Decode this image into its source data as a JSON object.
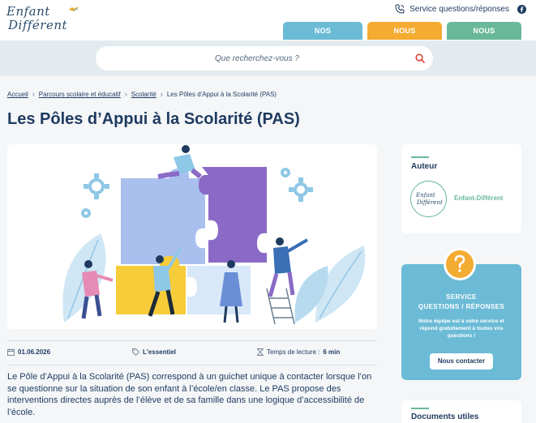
{
  "header": {
    "logo_line1": "Enfant",
    "logo_line2": "Différent",
    "service_link": "Service questions/réponses",
    "nav": [
      "NOS THÉMATIQUES",
      "NOUS CONNAÎTRE",
      "NOUS CONTACTER"
    ],
    "colors": {
      "blue": "#6bbbd6",
      "orange": "#f3ab32",
      "green": "#6ab89b"
    }
  },
  "search": {
    "placeholder": "Que recherchez-vous ?"
  },
  "breadcrumb": [
    "Accueil",
    "Parcours scolaire et éducatif",
    "Scolarité",
    "Les Pôles d'Appui à la Scolarité (PAS)"
  ],
  "page": {
    "title": "Les Pôles d’Appui à la Scolarité (PAS)",
    "date": "01.06.2026",
    "tag": "L'essentiel",
    "reading_label": "Temps de lecture :",
    "reading_time": "6 min",
    "intro": "Le Pôle d’Appui à la Scolarité (PAS) correspond à un guichet unique à contacter lorsque l’on se questionne sur la situation de son enfant à l’école/en classe. Le PAS propose des interventions directes auprès de l’élève et de sa famille dans une logique d’accessibilité de l’école."
  },
  "sidebar": {
    "author_title": "Auteur",
    "author_logo_line1": "Enfant",
    "author_logo_line2": "Différent",
    "author_name": "Enfant-Différent",
    "service_title_1": "SERVICE",
    "service_title_2": "QUESTIONS / RÉPONSES",
    "service_desc": "Notre équipe est à votre service et répond gratuitement à toutes vos questions !",
    "contact_button": "Nous contacter",
    "docs_title": "Documents utiles"
  },
  "icons": [
    "phone-icon",
    "facebook-icon",
    "search-icon",
    "chevron-right-icon",
    "calendar-icon",
    "tag-icon",
    "hourglass-icon",
    "question-icon"
  ]
}
